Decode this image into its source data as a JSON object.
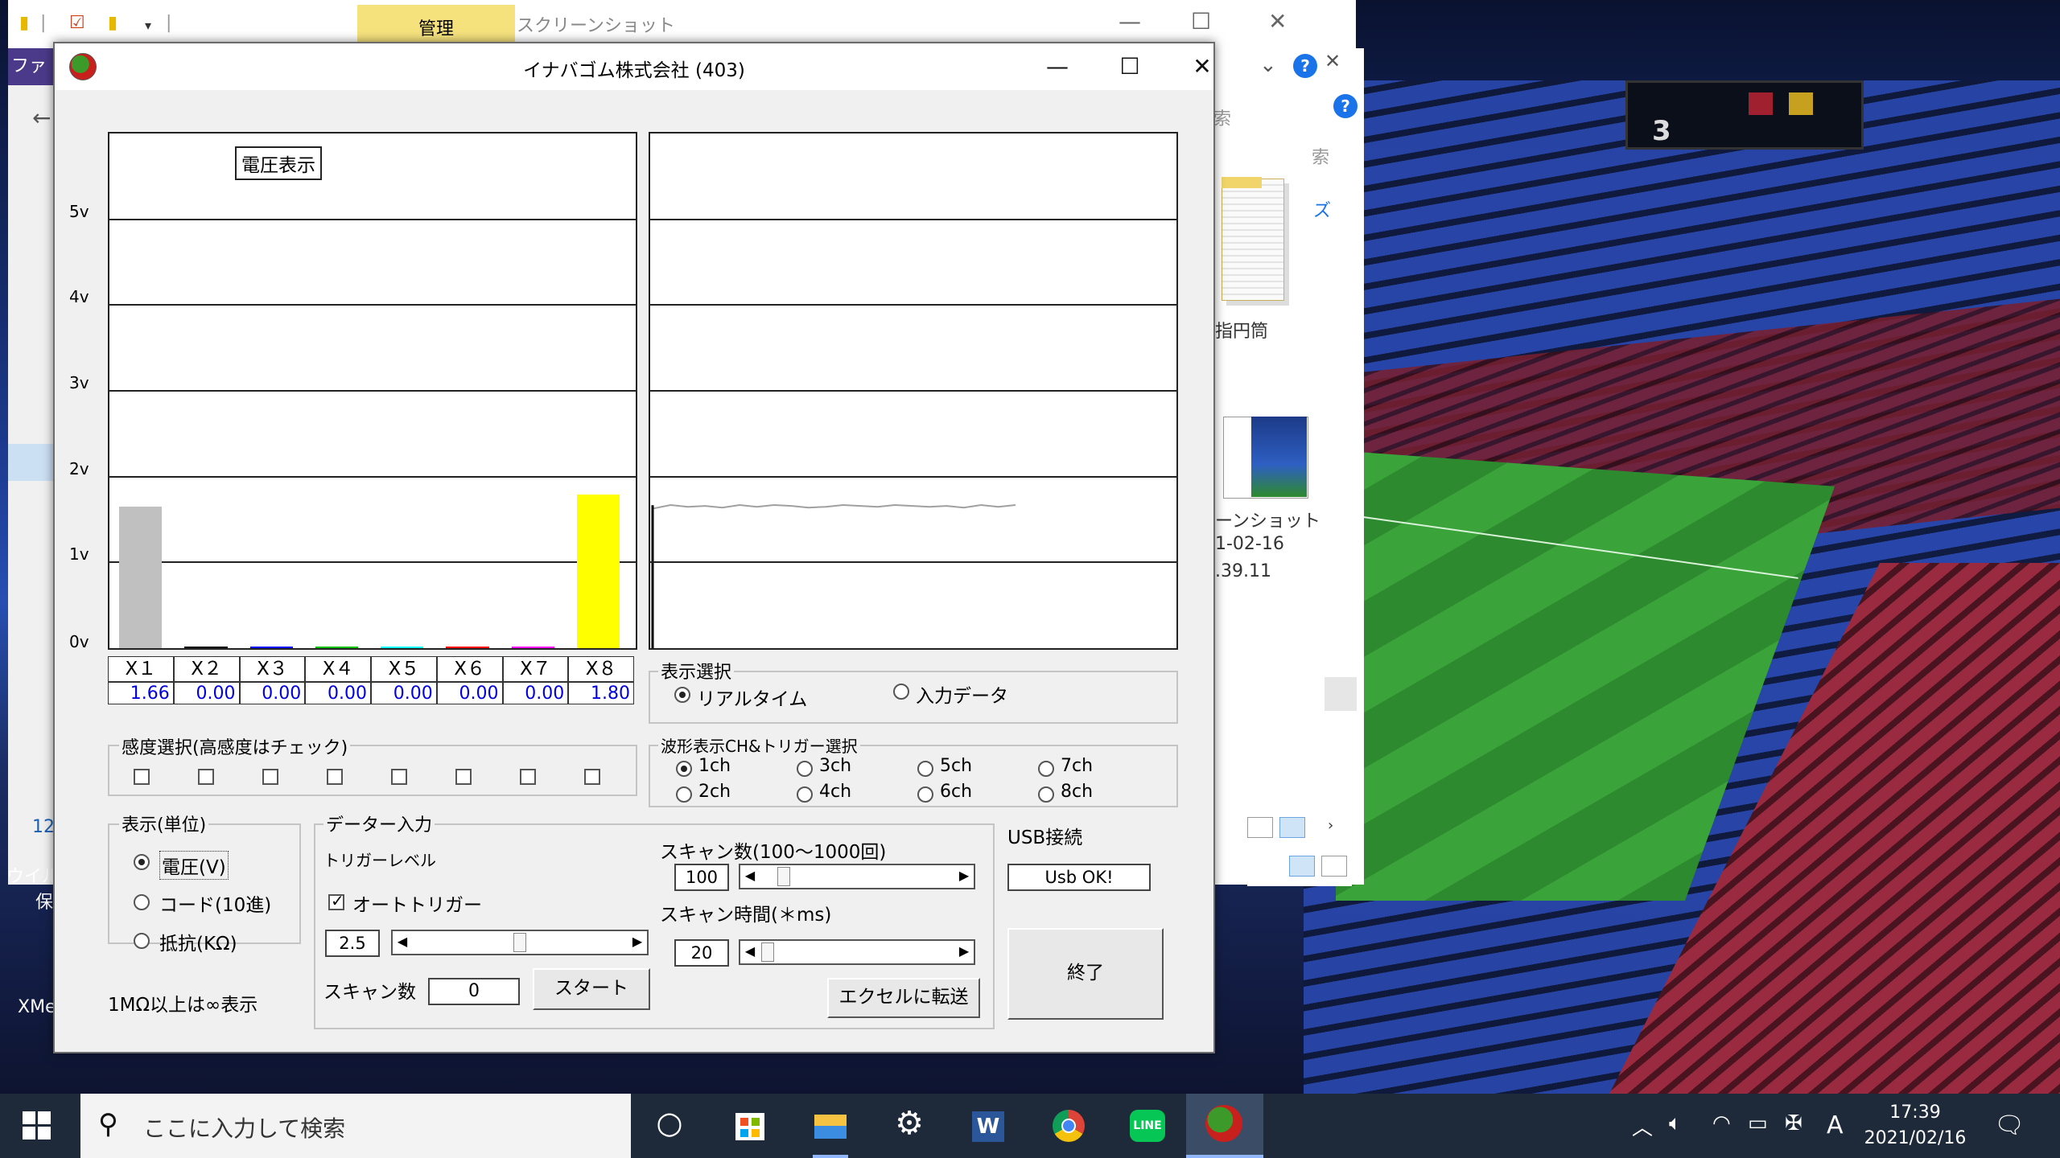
{
  "explorer": {
    "tab_manage": "管理",
    "title": "スクリーンショット",
    "left_purple_text": "ファ",
    "left_numbers": "12",
    "left_desktop_1": "ウイル",
    "left_desktop_2": "保",
    "left_desktop_3": "XMe",
    "right_search_frag": "索",
    "right_search_frag2": "索",
    "right_size_frag": "ズ",
    "folder_caption": "指円筒",
    "file_caption_1": "ーンショット",
    "file_caption_2": "1-02-16",
    "file_caption_3": ".39.11"
  },
  "app": {
    "title": "イナバゴム株式会社 (403)",
    "minimize": "—",
    "maximize": "☐",
    "close": "✕",
    "chart_title": "電圧表示",
    "y_ticks": [
      "5v",
      "4v",
      "3v",
      "2v",
      "1v",
      "0v"
    ],
    "channels": [
      "X１",
      "X２",
      "X３",
      "X４",
      "X５",
      "X６",
      "X７",
      "X８"
    ],
    "sensitivity_label": "感度選択(高感度はチェック)",
    "display_select": {
      "label": "表示選択",
      "options": [
        "リアルタイム",
        "入力データ"
      ],
      "selected": "リアルタイム"
    },
    "waveform_select": {
      "label": "波形表示CH&トリガー選択",
      "options": [
        "1ch",
        "3ch",
        "5ch",
        "7ch",
        "2ch",
        "4ch",
        "6ch",
        "8ch"
      ],
      "selected": "1ch"
    },
    "unit": {
      "label": "表示(単位)",
      "options": [
        "電圧(V)",
        "コード(10進)",
        "抵抗(KΩ)"
      ],
      "selected": "電圧(V)",
      "note": "1MΩ以上は∞表示"
    },
    "data_input": {
      "label": "データー入力",
      "trigger_level_label": "トリガーレベル",
      "auto_trigger_label": "オートトリガー",
      "auto_trigger_checked": true,
      "trigger_value": "2.5",
      "scan_count_label": "スキャン数",
      "scan_count_value": "0",
      "start_button": "スタート",
      "scan_n_label": "スキャン数(100〜1000回)",
      "scan_n_value": "100",
      "scan_time_label": "スキャン時間(＊ms)",
      "scan_time_value": "20",
      "excel_button": "エクセルに転送"
    },
    "usb": {
      "label": "USB接続",
      "status": "Usb OK!"
    },
    "exit_button": "終了"
  },
  "chart_data": {
    "type": "bar",
    "title": "電圧表示",
    "categories": [
      "X１",
      "X２",
      "X３",
      "X４",
      "X５",
      "X６",
      "X７",
      "X８"
    ],
    "values": [
      1.66,
      0.0,
      0.0,
      0.0,
      0.0,
      0.0,
      0.0,
      1.8
    ],
    "value_labels": [
      "1.66",
      "0.00",
      "0.00",
      "0.00",
      "0.00",
      "0.00",
      "0.00",
      "1.80"
    ],
    "bar_colors": [
      "#c0c0c0",
      "#000000",
      "#0000ff",
      "#00c000",
      "#00ffff",
      "#ff0000",
      "#ff00ff",
      "#ffff00"
    ],
    "yticks": [
      "5v",
      "4v",
      "3v",
      "2v",
      "1v",
      "0v"
    ],
    "ylim": [
      0,
      6
    ],
    "grid": true,
    "waveform": {
      "type": "line",
      "color": "#a0a0a0",
      "y": [
        1.62,
        1.66,
        1.64,
        1.65,
        1.63,
        1.66,
        1.64,
        1.66,
        1.65,
        1.63,
        1.64,
        1.66,
        1.65,
        1.64,
        1.66,
        1.65,
        1.64,
        1.65,
        1.63,
        1.66,
        1.64,
        1.66
      ]
    }
  },
  "taskbar": {
    "search_placeholder": "ここに入力して検索",
    "time": "17:39",
    "date": "2021/02/16",
    "ime": "A"
  }
}
